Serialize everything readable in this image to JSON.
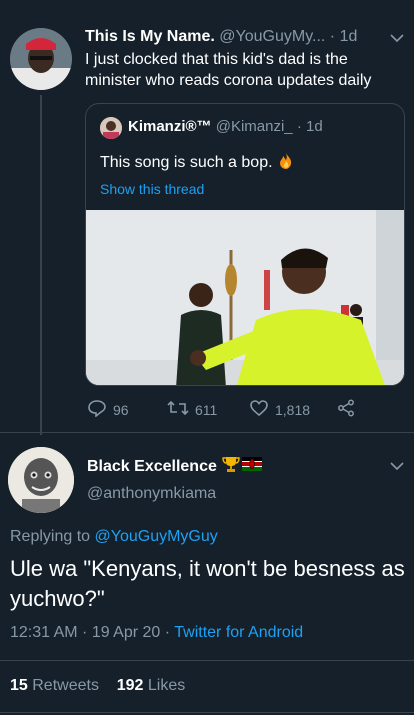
{
  "tweet": {
    "author_name": "This Is My Name.",
    "author_handle": "@YouGuyMy...",
    "time": "· 1d",
    "text": "I just clocked that this kid's dad is the minister who reads corona updates daily",
    "quote": {
      "author_name": "Kimanzi®™",
      "author_handle": "@Kimanzi_",
      "time": "· 1d",
      "text": "This song is such a bop.",
      "show_thread": "Show this thread"
    },
    "replies": "96",
    "retweets": "611",
    "likes": "1,818"
  },
  "reply": {
    "author_name": "Black Excellence",
    "author_handle": "@anthonymkiama",
    "replying_prefix": "Replying to",
    "replying_to": "@YouGuyMyGuy",
    "text": "Ule wa \"Kenyans, it won't be besness as yuchwo?\"",
    "timestamp": "12:31 AM · 19 Apr 20 ·",
    "source": "Twitter for Android",
    "retweet_count": "15",
    "retweet_label": "Retweets",
    "like_count": "192",
    "like_label": "Likes"
  },
  "icons": {
    "reply": "reply-icon",
    "retweet": "retweet-icon",
    "like": "heart-icon",
    "share": "share-icon",
    "fire": "fire-icon",
    "trophy": "trophy-icon",
    "flag": "kenya-flag-icon"
  },
  "colors": {
    "background": "#15202b",
    "secondary_text": "#8899a6",
    "link": "#1da1f2",
    "border": "#38444d"
  }
}
